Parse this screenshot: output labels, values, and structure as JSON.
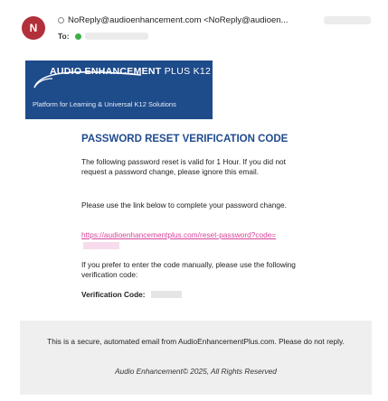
{
  "email": {
    "sender_initial": "N",
    "from": "NoReply@audioenhancement.com <NoReply@audioen...",
    "to_label": "To:"
  },
  "banner": {
    "logo_main": "AUDIO ENHANCEMENT",
    "logo_plus": "PLUS K12",
    "tagline": "Platform for Learning & Universal K12 Solutions"
  },
  "body": {
    "title": "PASSWORD RESET VERIFICATION CODE",
    "paragraph1": "The following password reset is valid for 1 Hour. If you did not request a password change, please ignore this email.",
    "paragraph2": "Please use the link below to complete your password change.",
    "reset_link": "https://audioenhancementplus.com/reset-password?code=",
    "paragraph3": "If you prefer to enter the code manually, please use the following verification code:",
    "verification_label": "Verification Code:"
  },
  "footer": {
    "notice": "This is a secure, automated email from AudioEnhancementPlus.com. Please do not reply.",
    "copyright": "Audio Enhancement© 2025, All Rights Reserved"
  }
}
